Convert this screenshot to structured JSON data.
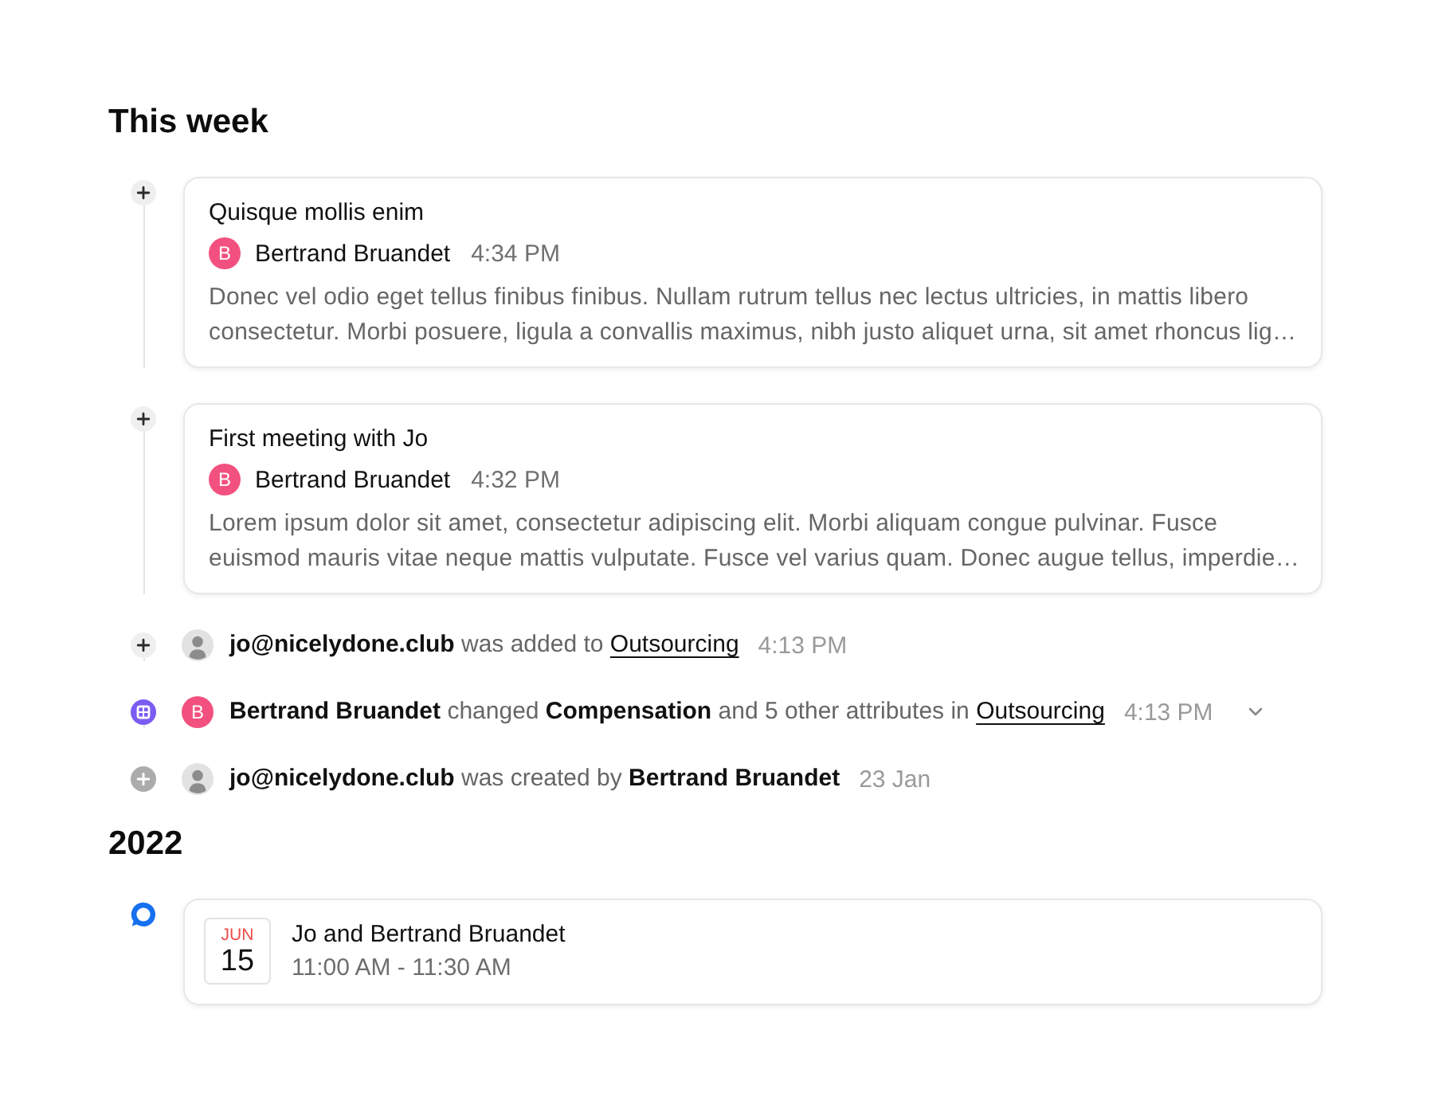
{
  "sections": [
    {
      "heading": "This week",
      "items": [
        {
          "kind": "note",
          "marker": {
            "kind": "plus"
          },
          "title": "Quisque mollis enim",
          "author": {
            "initial": "B",
            "name": "Bertrand Bruandet"
          },
          "time": "4:34 PM",
          "preview": "Donec vel odio eget tellus finibus finibus. Nullam rutrum tellus nec lectus ultricies, in mattis libero consectetur. Morbi posuere, ligula a convallis maximus, nibh justo aliquet urna, sit amet rhoncus lig…"
        },
        {
          "kind": "note",
          "marker": {
            "kind": "plus"
          },
          "title": "First meeting with Jo",
          "author": {
            "initial": "B",
            "name": "Bertrand Bruandet"
          },
          "time": "4:32 PM",
          "preview": "Lorem ipsum dolor sit amet, consectetur adipiscing elit. Morbi aliquam congue pulvinar. Fusce euismod mauris vitae neque mattis vulputate. Fusce vel varius quam. Donec augue tellus, imperdie…"
        },
        {
          "kind": "activity",
          "marker": {
            "kind": "plus"
          },
          "avatar": {
            "kind": "person"
          },
          "text": "**jo@nicelydone.club** was added to",
          "link": "Outsourcing",
          "time": "4:13 PM"
        },
        {
          "kind": "activity",
          "marker": {
            "kind": "grid"
          },
          "avatar": {
            "kind": "initial",
            "initial": "B"
          },
          "text": "**Bertrand Bruandet** changed **Compensation** and 5 other attributes in",
          "link": "Outsourcing",
          "time": "4:13 PM",
          "expanded": false
        },
        {
          "kind": "activity",
          "marker": {
            "kind": "plus-filled"
          },
          "avatar": {
            "kind": "person"
          },
          "text": "**jo@nicelydone.club** was created by **Bertrand Bruandet**",
          "time": "23 Jan"
        }
      ]
    },
    {
      "heading": "2022",
      "items": [
        {
          "kind": "event",
          "marker": {
            "kind": "chat"
          },
          "month": "JUN",
          "day": "15",
          "title": "Jo and Bertrand Bruandet",
          "time": "11:00 AM - 11:30 AM"
        }
      ]
    }
  ]
}
